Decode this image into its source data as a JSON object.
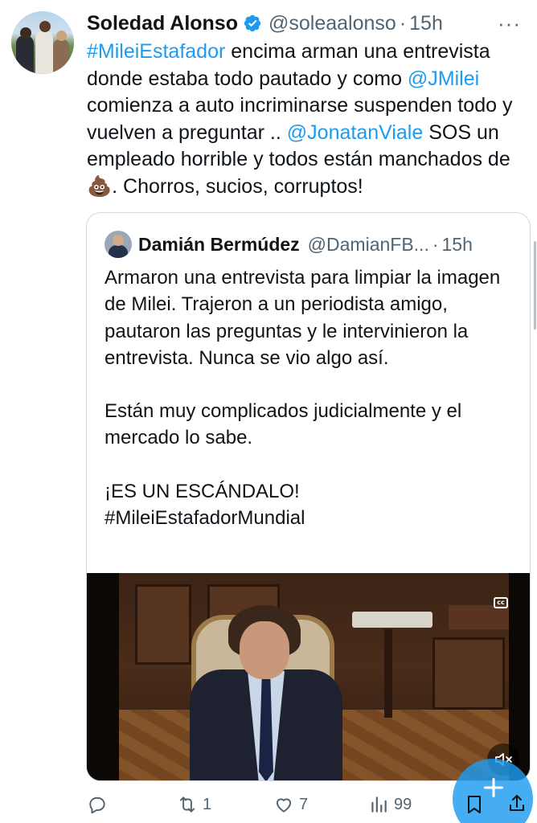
{
  "author": {
    "name": "Soledad Alonso",
    "handle": "@soleaalonso",
    "separator": "·",
    "time": "15h"
  },
  "more_label": "···",
  "tweet": {
    "line_pre": "",
    "hashtag_1": "#MileiEstafador",
    "text_1": " encima arman una entrevista donde estaba todo pautado y como ",
    "mention_1": "@JMilei",
    "text_2": " comienza a auto incriminarse suspenden todo y vuelven a preguntar .. ",
    "mention_2": "@JonatanViale",
    "text_3": " SOS un empleado horrible y todos están manchados de ",
    "emoji": "💩",
    "text_4": ". Chorros, sucios, corruptos!"
  },
  "quote": {
    "name": "Damián Bermúdez",
    "handle": "@DamianFB...",
    "separator": "·",
    "time": "15h",
    "paragraph_1": "Armaron una entrevista para limpiar la imagen de Milei. Trajeron a un periodista amigo, pautaron las preguntas y le intervinieron la entrevista. Nunca se vio algo así.",
    "paragraph_2": "Están muy complicados judicialmente y el mercado lo sabe.",
    "paragraph_3_line_1": "¡ES UN ESCÁNDALO!",
    "paragraph_3_line_2": "#MileiEstafadorMundial",
    "video": {
      "cc_label": "cc"
    }
  },
  "actions": {
    "replies": "",
    "retweets": "1",
    "likes": "7",
    "views": "99"
  },
  "colors": {
    "accent": "#1d9bf0",
    "text": "#0f1419",
    "secondary": "#536471",
    "border": "#cfd9de"
  },
  "icons": [
    "verified-badge-icon",
    "more-icon",
    "reply-icon",
    "retweet-icon",
    "like-icon",
    "views-icon",
    "bookmark-icon",
    "share-icon",
    "compose-plus-icon",
    "closed-captions-icon",
    "mute-icon"
  ]
}
